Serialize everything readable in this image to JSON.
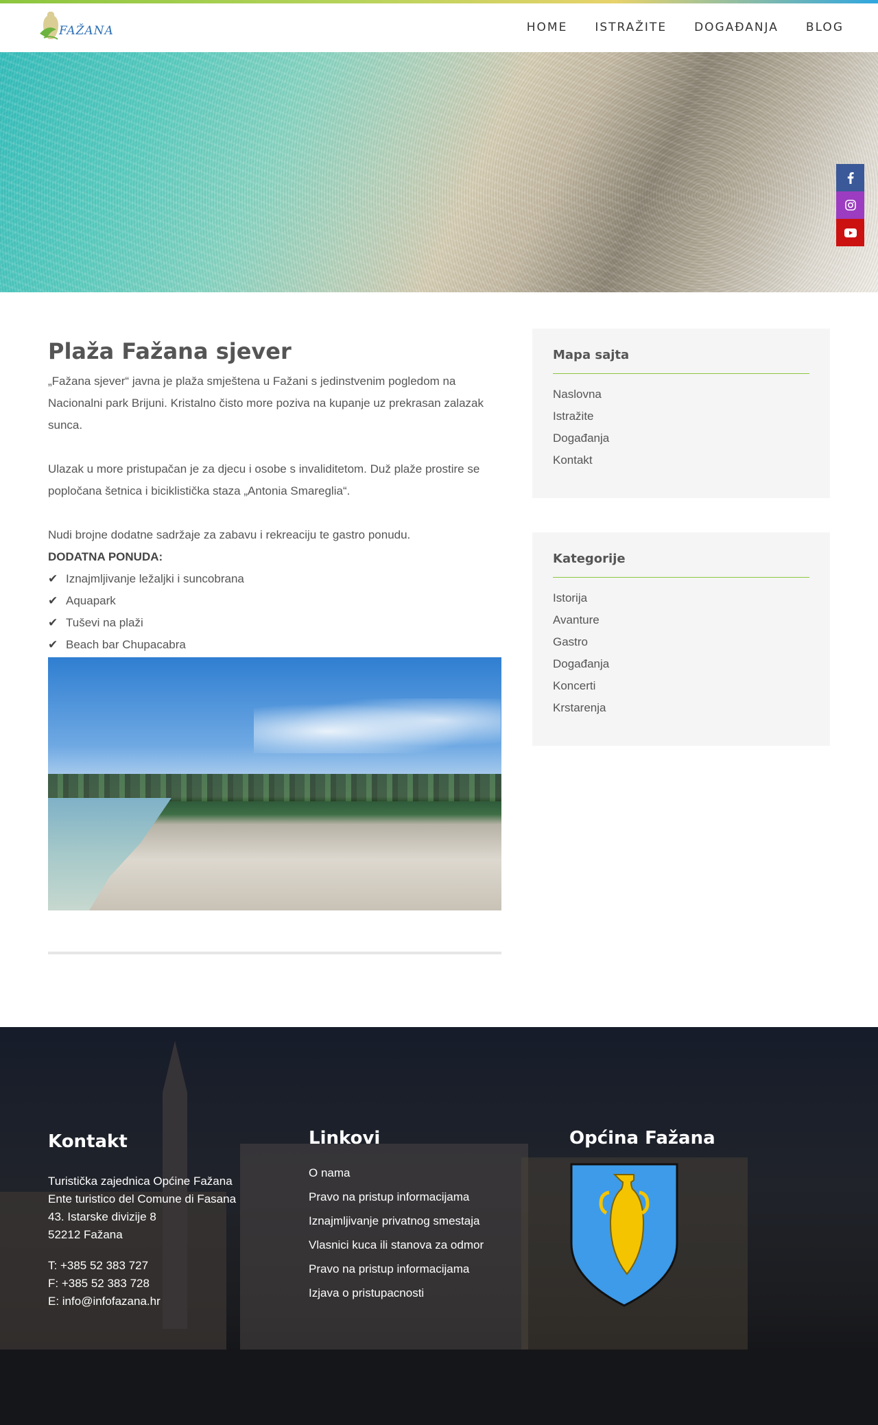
{
  "brand": {
    "logo_text": "FAŽANA"
  },
  "nav": {
    "items": [
      "HOME",
      "ISTRAŽITE",
      "DOGAĐANJA",
      "BLOG"
    ]
  },
  "social": {
    "icons": [
      "facebook-icon",
      "instagram-icon",
      "youtube-icon"
    ],
    "colors": [
      "#3b5998",
      "#9c3cc0",
      "#cc1111"
    ]
  },
  "article": {
    "title": "Plaža Fažana sjever",
    "paragraph1": "„Fažana sjever“ javna je plaža smještena u Fažani s jedinstvenim pogledom na Nacionalni park Brijuni. Kristalno čisto more poziva na kupanje uz prekrasan zalazak sunca.",
    "paragraph2": "Ulazak u more pristupačan je za djecu i osobe s invaliditetom. Duž plaže prostire se popločana šetnica i biciklistička staza „Antonia Smareglia“.",
    "paragraph3": "Nudi brojne dodatne sadržaje za zabavu i rekreaciju te gastro ponudu.",
    "extras_label": "DODATNA PONUDA:",
    "extras": [
      "Iznajmljivanje ležaljki i suncobrana",
      "Aquapark",
      "Tuševi na plaži",
      "Beach bar Chupacabra"
    ]
  },
  "sidebar": {
    "sitemap": {
      "title": "Mapa sajta",
      "items": [
        "Naslovna",
        "Istražite",
        "Događanja",
        "Kontakt"
      ]
    },
    "categories": {
      "title": "Kategorije",
      "items": [
        "Istorija",
        "Avanture",
        "Gastro",
        "Događanja",
        "Koncerti",
        "Krstarenja"
      ]
    }
  },
  "footer": {
    "contact": {
      "title": "Kontakt",
      "lines": [
        "Turistička zajednica Općine Fažana",
        "Ente turistico del Comune di Fasana",
        "43. Istarske divizije 8",
        "52212 Fažana"
      ],
      "phone": "T: +385 52 383 727",
      "fax": "F: +385 52 383 728",
      "email": "E: info@infofazana.hr"
    },
    "links": {
      "title": "Linkovi",
      "items": [
        "O nama",
        "Pravo na pristup informacijama",
        "Iznajmljivanje privatnog smestaja",
        "Vlasnici kuca ili stanova za odmor",
        "Pravo na pristup informacijama",
        "Izjava o pristupacnosti"
      ]
    },
    "municipality": {
      "title": "Općina Fažana"
    }
  },
  "colors": {
    "accent_green": "#8cc63f",
    "shield_blue": "#3d9be9",
    "amphora_yellow": "#f5c400"
  }
}
